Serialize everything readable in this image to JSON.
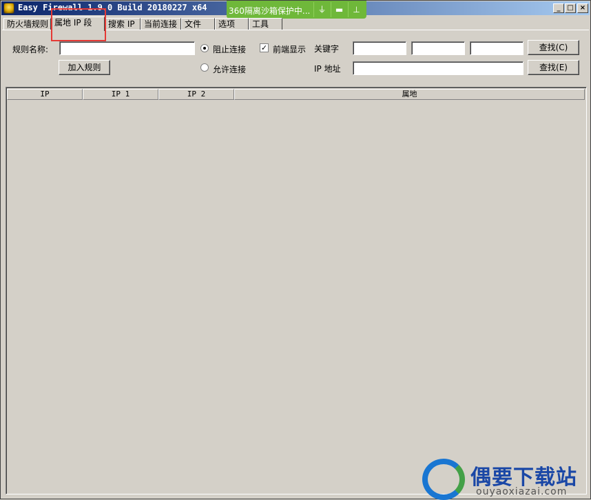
{
  "window": {
    "title": "Easy Firewall 1.9.0 Build 20180227 x64",
    "controls": {
      "minimize": "_",
      "maximize": "□",
      "close": "×"
    }
  },
  "sandbox_bar": {
    "text": "360隔离沙箱保护中...",
    "icons": [
      "plug-icon",
      "folder-icon",
      "pin-icon"
    ]
  },
  "tabs": [
    {
      "label": "防火墙规则",
      "active": false
    },
    {
      "label": "属地 IP 段",
      "active": true
    },
    {
      "label": "搜索 IP",
      "active": false
    },
    {
      "label": "当前连接",
      "active": false
    },
    {
      "label": "文件",
      "active": false
    },
    {
      "label": "选项",
      "active": false
    },
    {
      "label": "工具",
      "active": false
    }
  ],
  "form": {
    "rule_name_label": "规则名称:",
    "rule_name_value": "",
    "add_rule_button": "加入规则",
    "block_label": "阻止连接",
    "block_checked": true,
    "allow_label": "允许连接",
    "allow_checked": false,
    "front_display_label": "前端显示",
    "front_display_checked": true,
    "keyword_label": "关键字",
    "keyword_values": [
      "",
      "",
      ""
    ],
    "find_button_1": "查找(C)",
    "ip_address_label": "IP 地址",
    "ip_address_value": "",
    "find_button_2": "查找(E)"
  },
  "table": {
    "columns": [
      "IP",
      "IP 1",
      "IP 2",
      "属地"
    ],
    "rows": []
  },
  "watermark": {
    "text": "偶要下载站",
    "subtext": "ouyaoxiazai.com"
  },
  "colors": {
    "window_bg": "#d4d0c8",
    "title_gradient_start": "#0a246a",
    "sandbox_green": "#6fb83a",
    "highlight_red": "#e53935",
    "watermark_blue": "#1a47a6"
  }
}
